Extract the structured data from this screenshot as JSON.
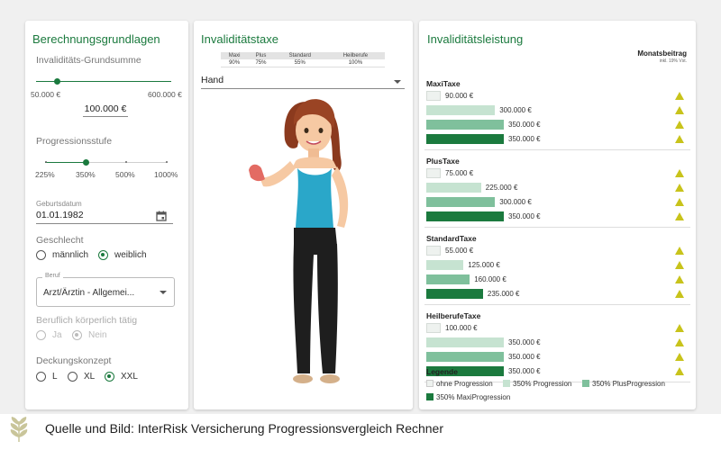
{
  "left": {
    "title": "Berechnungsgrundlagen",
    "grundsumme": {
      "label": "Invaliditäts-Grundsumme",
      "min_label": "50.000 €",
      "max_label": "600.000 €",
      "value": "100.000 €",
      "fraction": 0.05
    },
    "progression": {
      "label": "Progressionsstufe",
      "ticks": [
        "225%",
        "350%",
        "500%",
        "1000%"
      ],
      "selected": "350%"
    },
    "geburtsdatum": {
      "label": "Geburtsdatum",
      "value": "01.01.1982",
      "icon": "calendar-icon"
    },
    "geschlecht": {
      "label": "Geschlecht",
      "options": [
        "männlich",
        "weiblich"
      ],
      "selected": "weiblich"
    },
    "beruf": {
      "label": "Beruf",
      "value": "Arzt/Ärztin - Allgemei..."
    },
    "koerperlich": {
      "label": "Beruflich körperlich tätig",
      "options": [
        "Ja",
        "Nein"
      ],
      "selected": "Nein"
    },
    "deckung": {
      "label": "Deckungskonzept",
      "options": [
        "L",
        "XL",
        "XXL"
      ],
      "selected": "XXL"
    }
  },
  "middle": {
    "title": "Invaliditätstaxe",
    "table": {
      "headers": [
        "Maxi",
        "Plus",
        "Standard",
        "Heilberufe"
      ],
      "values": [
        "90%",
        "75%",
        "55%",
        "100%"
      ]
    },
    "select_value": "Hand"
  },
  "right": {
    "title": "Invaliditätsleistung",
    "monthly_header": "Monatsbeitrag",
    "monthly_sub": "inkl. 19% Vst.",
    "sections": [
      {
        "title": "MaxiTaxe",
        "rows": [
          {
            "value": "90.000 €",
            "level": 0.0
          },
          {
            "value": "300.000 €",
            "level": 0.86
          },
          {
            "value": "350.000 €",
            "level": 1.0
          },
          {
            "value": "350.000 €",
            "level": 1.0
          }
        ]
      },
      {
        "title": "PlusTaxe",
        "rows": [
          {
            "value": "75.000 €",
            "level": 0.0
          },
          {
            "value": "225.000 €",
            "level": 0.64
          },
          {
            "value": "300.000 €",
            "level": 0.86
          },
          {
            "value": "350.000 €",
            "level": 1.0
          }
        ]
      },
      {
        "title": "StandardTaxe",
        "rows": [
          {
            "value": "55.000 €",
            "level": 0.0
          },
          {
            "value": "125.000 €",
            "level": 0.36
          },
          {
            "value": "160.000 €",
            "level": 0.46
          },
          {
            "value": "235.000 €",
            "level": 0.67
          }
        ]
      },
      {
        "title": "HeilberufeTaxe",
        "rows": [
          {
            "value": "100.000 €",
            "level": 0.0
          },
          {
            "value": "350.000 €",
            "level": 1.0
          },
          {
            "value": "350.000 €",
            "level": 1.0
          },
          {
            "value": "350.000 €",
            "level": 1.0
          }
        ]
      }
    ],
    "row_colors": [
      "#eef2ef",
      "#c6e3d1",
      "#7fc09c",
      "#1b7a3e"
    ],
    "legend_title": "Legende",
    "legend": [
      "ohne Progression",
      "350% Progression",
      "350% PlusProgression",
      "350% MaxiProgression"
    ],
    "warn_color": "#c8c31b"
  },
  "caption": "Quelle und Bild: InterRisk Versicherung Progressionsvergleich Rechner",
  "brand_icon": "wheat-logo-icon"
}
